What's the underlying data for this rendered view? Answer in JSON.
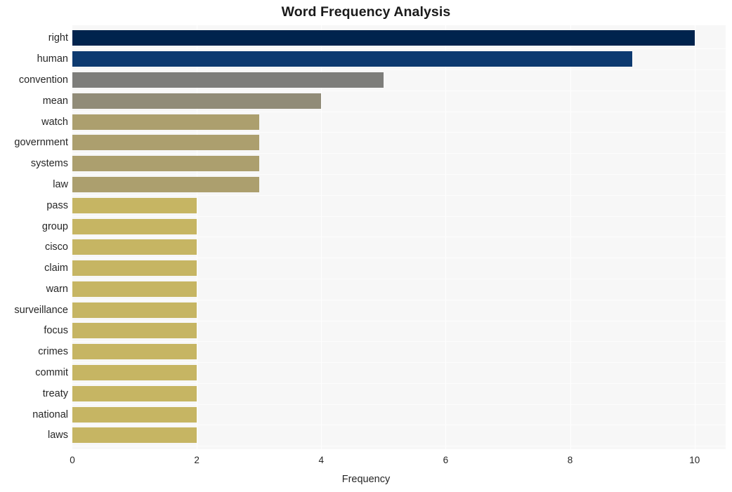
{
  "chart_data": {
    "type": "bar",
    "orientation": "horizontal",
    "title": "Word Frequency Analysis",
    "xlabel": "Frequency",
    "ylabel": "",
    "xlim": [
      0,
      10.5
    ],
    "xticks": [
      0,
      2,
      4,
      6,
      8,
      10
    ],
    "xtick_labels": [
      "0",
      "2",
      "4",
      "6",
      "8",
      "10"
    ],
    "grid": true,
    "grid_axis": "x",
    "legend": false,
    "categories": [
      "right",
      "human",
      "convention",
      "mean",
      "watch",
      "government",
      "systems",
      "law",
      "pass",
      "group",
      "cisco",
      "claim",
      "warn",
      "surveillance",
      "focus",
      "crimes",
      "commit",
      "treaty",
      "national",
      "laws"
    ],
    "values": [
      10,
      9,
      5,
      4,
      3,
      3,
      3,
      3,
      2,
      2,
      2,
      2,
      2,
      2,
      2,
      2,
      2,
      2,
      2,
      2
    ],
    "bar_colors": [
      "#00234d",
      "#0d3a70",
      "#7d7d7a",
      "#918c78",
      "#ac9f6e",
      "#ac9f6e",
      "#ac9f6e",
      "#ac9f6e",
      "#c6b563",
      "#c6b563",
      "#c6b563",
      "#c6b563",
      "#c6b563",
      "#c6b563",
      "#c6b563",
      "#c6b563",
      "#c6b563",
      "#c6b563",
      "#c6b563",
      "#c6b563"
    ]
  },
  "style": {
    "figure_background": "#ffffff",
    "plot_background": "#f7f7f7",
    "gridline_color": "#ffffff",
    "text_color": "#262626",
    "title_color": "#1a1a1a"
  }
}
